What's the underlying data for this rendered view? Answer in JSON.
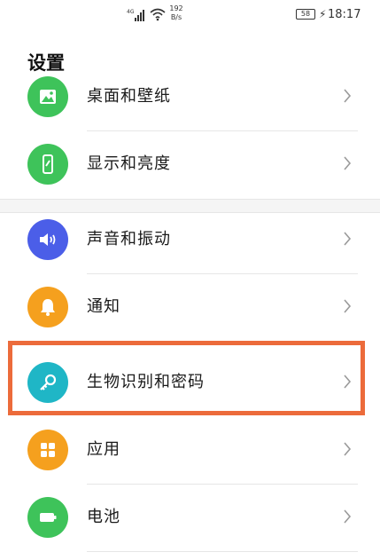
{
  "status_bar": {
    "network": "4G",
    "speed_value": "192",
    "speed_unit": "B/s",
    "battery": "58",
    "time": "18:17"
  },
  "header": {
    "title": "设置"
  },
  "items": [
    {
      "label": "桌面和壁纸",
      "icon": "wallpaper-icon",
      "color": "#3ec35a"
    },
    {
      "label": "显示和亮度",
      "icon": "display-phone-icon",
      "color": "#3ec35a"
    },
    {
      "label": "声音和振动",
      "icon": "speaker-icon",
      "color": "#4b5ee8"
    },
    {
      "label": "通知",
      "icon": "bell-icon",
      "color": "#f5a01e"
    },
    {
      "label": "生物识别和密码",
      "icon": "key-icon",
      "color": "#1fb6c6"
    },
    {
      "label": "应用",
      "icon": "apps-grid-icon",
      "color": "#f5a01e"
    },
    {
      "label": "电池",
      "icon": "battery-icon",
      "color": "#3ec35a"
    }
  ],
  "highlight_color": "#ec6b3b"
}
